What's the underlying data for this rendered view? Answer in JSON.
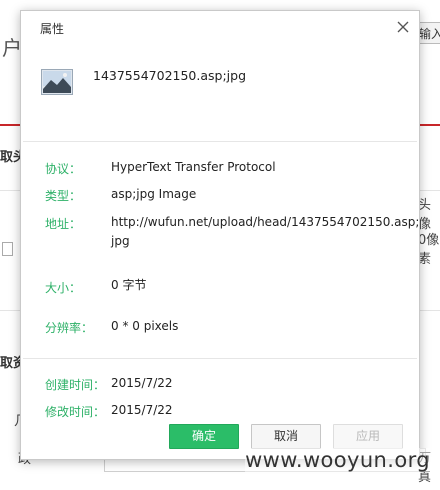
{
  "background": {
    "char_hu": "户",
    "input_button": "输入",
    "section_tou": "取头",
    "right_text_1": "头像",
    "right_text_2": "0像素",
    "section_zi": "取资",
    "small_text_1": "几",
    "small_text_2": "政",
    "gen_text": "万真"
  },
  "dialog": {
    "title": "属性",
    "file_name": "1437554702150.asp;jpg",
    "protocol_label": "协议：",
    "protocol_value": "HyperText Transfer Protocol",
    "type_label": "类型：",
    "type_value": "asp;jpg Image",
    "address_label": "地址：",
    "address_value_line1": "http://wufun.net/upload/head/1437554702150.asp;",
    "address_value_line2": "jpg",
    "size_label": "大小：",
    "size_value": "0 字节",
    "resolution_label": "分辨率：",
    "resolution_value": "0 * 0 pixels",
    "created_label": "创建时间：",
    "created_value": "2015/7/22",
    "modified_label": "修改时间：",
    "modified_value": "2015/7/22",
    "ok_label": "确定",
    "cancel_label": "取消",
    "apply_label": "应用"
  },
  "watermark": "www.wooyun.org",
  "colors": {
    "accent_green": "#2bbd68",
    "label_green": "#2eb168",
    "red_line": "#c8262a"
  }
}
